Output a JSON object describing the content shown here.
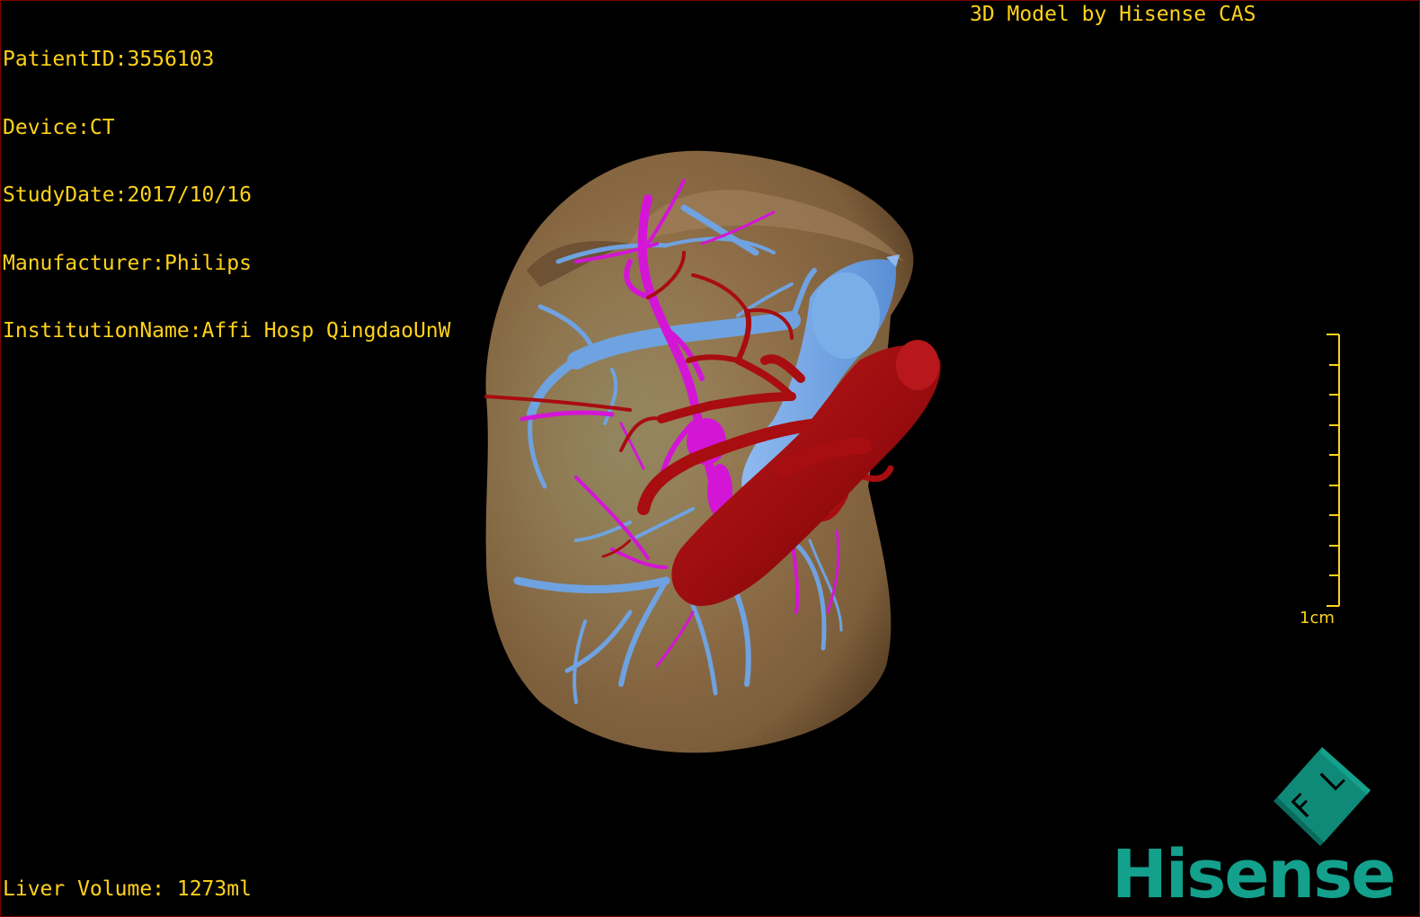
{
  "header": {
    "patient_id": "PatientID:3556103",
    "device": "Device:CT",
    "study_date": "StudyDate:2017/10/16",
    "manufacturer": "Manufacturer:Philips",
    "institution": "InstitutionName:Affi Hosp QingdaoUnW"
  },
  "watermark": {
    "title": "3D Model by Hisense CAS"
  },
  "footer": {
    "liver_volume": "Liver Volume: 1273ml"
  },
  "scale_bar": {
    "label": "1cm"
  },
  "orientation_cube": {
    "letters": [
      "F",
      "L"
    ]
  },
  "brand": {
    "logo_text": "Hisense"
  },
  "colors": {
    "overlay_text": "#ffd21a",
    "liver": "#8a6a45",
    "portal_vein": "#6fa2e0",
    "hepatic_artery": "#a80d10",
    "hepatic_vein": "#d316d6",
    "brand": "#13a08c",
    "background": "#000000"
  },
  "icons": [
    "orientation-cube-icon",
    "hisense-logo"
  ]
}
